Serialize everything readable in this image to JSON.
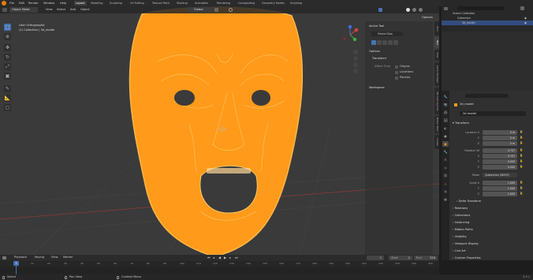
{
  "topbar": {
    "menus": [
      "File",
      "Edit",
      "Render",
      "Window",
      "Help"
    ],
    "workspaces": [
      "Layout",
      "Modeling",
      "Sculpting",
      "UV Editing",
      "Texture Paint",
      "Shading",
      "Animation",
      "Rendering",
      "Compositing",
      "Geometry Nodes",
      "Scripting"
    ],
    "active_workspace": "Layout",
    "scene_name": "Scene",
    "view_layer": "ViewLayer"
  },
  "viewport_header": {
    "mode": "Object Mode",
    "menus": [
      "View",
      "Select",
      "Add",
      "Object"
    ],
    "orientation": "Global",
    "options": "Options"
  },
  "overlay_text": {
    "view_name": "User Orthographic",
    "collection": "(1) Collection | 3d_model"
  },
  "npanel": {
    "active_tool": "Active Tool",
    "tool_name": "Select Box",
    "options": "Options",
    "transform": "Transform",
    "affect_only": "Affect Only",
    "origins": "Origins",
    "locations": "Locations",
    "parents": "Parents",
    "workspace": "Workspace",
    "tabs": [
      "Item",
      "Tool",
      "View",
      "Lamp Manager",
      "3D-Coat Applink",
      "Bezier Tools",
      "Create"
    ]
  },
  "outliner": {
    "rows": [
      {
        "label": "Scene Collection",
        "selected": false
      },
      {
        "label": "Collection",
        "selected": false
      },
      {
        "label": "3d_model",
        "selected": true
      }
    ]
  },
  "properties": {
    "object_name": "3d_model",
    "data_name": "3d model",
    "section_transform": "Transform",
    "location_label": "Location X",
    "y_label": "Y",
    "z_label": "Z",
    "location": [
      "0 m",
      "0 m",
      "0 m"
    ],
    "rotation_label": "Rotation W",
    "x_label": "X",
    "rotation": [
      "0.707",
      "0.707",
      "0.000",
      "0.000"
    ],
    "mode_label": "Mode",
    "mode_value": "Quaternion (WXYZ)",
    "scale_label": "Scale X",
    "scale": [
      "1.000",
      "1.000",
      "1.000"
    ],
    "delta_transform": "Delta Transform",
    "sections": [
      "Relations",
      "Collections",
      "Instancing",
      "Motion Paths",
      "Visibility",
      "Viewport Display",
      "Line Art",
      "Custom Properties"
    ]
  },
  "timeline": {
    "playback": "Playback",
    "keying": "Keying",
    "view": "View",
    "marker": "Marker",
    "current_frame": "1",
    "start_label": "Start",
    "start": "1",
    "end_label": "End",
    "end": "250",
    "ticks": [
      "0",
      "10",
      "20",
      "30",
      "40",
      "50",
      "60",
      "70",
      "80",
      "90",
      "100",
      "110",
      "120",
      "130",
      "140",
      "150",
      "160",
      "170",
      "180",
      "190",
      "200",
      "210",
      "220",
      "230",
      "240",
      "250"
    ]
  },
  "statusbar": {
    "items": [
      "Select",
      "Pan View",
      "Context Menu"
    ],
    "version": "3.3.1"
  },
  "colors": {
    "accent": "#4772b3",
    "mesh": "#ff9a1a",
    "mesh_edge": "#ffcb6b",
    "viewport_bg": "#3a3a3a"
  }
}
